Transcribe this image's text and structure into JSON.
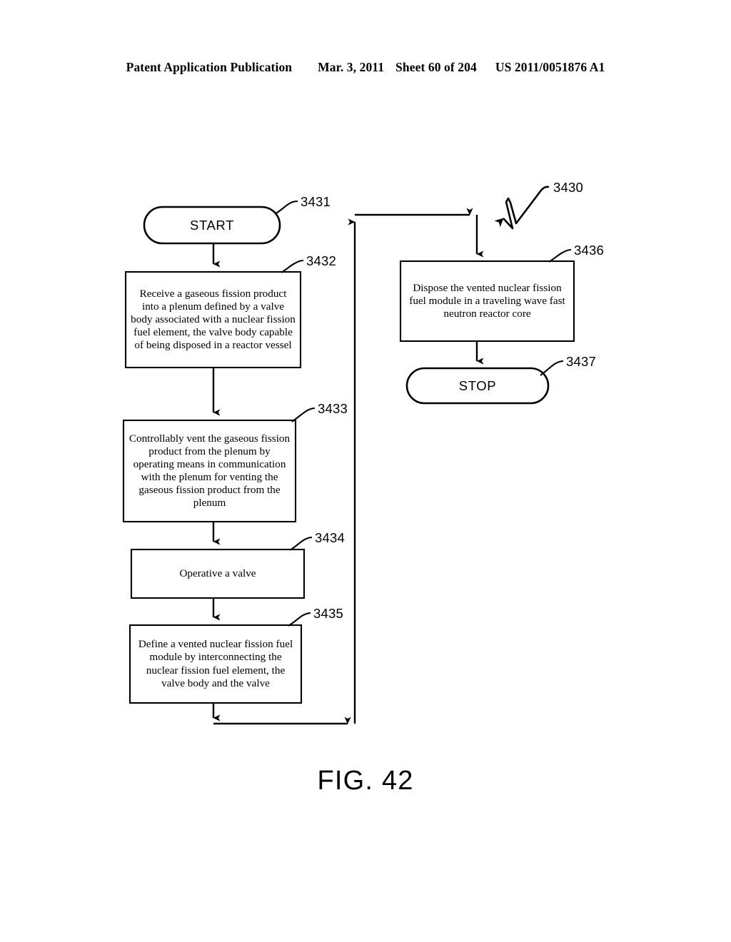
{
  "header": {
    "publication": "Patent Application Publication",
    "date": "Mar. 3, 2011",
    "sheet": "Sheet 60 of 204",
    "patent_number": "US 2011/0051876 A1"
  },
  "figure": {
    "caption": "FIG. 42",
    "diagram_ref": "3430",
    "type": "flowchart",
    "ink_color": "#000000",
    "background_color": "#ffffff"
  },
  "nodes": {
    "start": {
      "ref": "3431",
      "label": "START",
      "shape": "stadium"
    },
    "step1": {
      "ref": "3432",
      "label": "Receive a gaseous fission product into a plenum defined by a valve body associated with a nuclear fission fuel element, the valve body capable of being disposed in a reactor vessel",
      "shape": "rect"
    },
    "step2": {
      "ref": "3433",
      "label": "Controllably vent the gaseous fission product from the plenum by operating means in communication with the plenum for venting the gaseous fission product from the plenum",
      "shape": "rect"
    },
    "step3": {
      "ref": "3434",
      "label": "Operative a valve",
      "shape": "rect"
    },
    "step4": {
      "ref": "3435",
      "label": "Define a vented nuclear fission fuel module by interconnecting the nuclear fission fuel element, the valve body and the valve",
      "shape": "rect"
    },
    "step5": {
      "ref": "3436",
      "label": "Dispose the vented nuclear fission fuel module in a traveling wave fast neutron reactor core",
      "shape": "rect"
    },
    "stop": {
      "ref": "3437",
      "label": "STOP",
      "shape": "stadium"
    }
  },
  "edges": [
    {
      "from": "start",
      "to": "step1"
    },
    {
      "from": "step1",
      "to": "step2"
    },
    {
      "from": "step2",
      "to": "step3"
    },
    {
      "from": "step3",
      "to": "step4"
    },
    {
      "from": "step4",
      "to": "return-bus"
    },
    {
      "from": "return-bus",
      "to": "step5"
    },
    {
      "from": "step5",
      "to": "stop"
    }
  ]
}
